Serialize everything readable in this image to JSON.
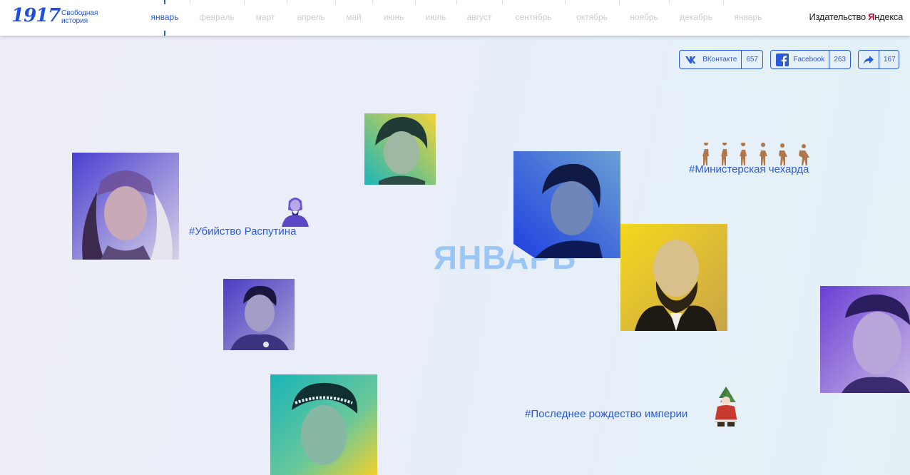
{
  "header": {
    "logo_number": "1917",
    "logo_subtitle": "Свободная история",
    "publisher_prefix": "Издательство ",
    "publisher_brand": "Я",
    "publisher_rest": "ндекса",
    "months": [
      {
        "label": "январь",
        "active": true
      },
      {
        "label": "февраль",
        "active": false
      },
      {
        "label": "март",
        "active": false
      },
      {
        "label": "апрель",
        "active": false
      },
      {
        "label": "май",
        "active": false
      },
      {
        "label": "июнь",
        "active": false
      },
      {
        "label": "июль",
        "active": false
      },
      {
        "label": "август",
        "active": false
      },
      {
        "label": "сентябрь",
        "active": false
      },
      {
        "label": "октябрь",
        "active": false
      },
      {
        "label": "ноябрь",
        "active": false
      },
      {
        "label": "декабрь",
        "active": false
      },
      {
        "label": "январь",
        "active": false
      }
    ]
  },
  "share": {
    "vk": {
      "label": "ВКонтакте",
      "count": "657",
      "icon": "vk-icon"
    },
    "facebook": {
      "label": "Facebook",
      "count": "263",
      "icon": "facebook-icon"
    },
    "repost": {
      "count": "167",
      "icon": "share-arrow-icon"
    }
  },
  "main": {
    "month_title": "ЯНВАРЬ",
    "tags": {
      "rasputin": "#Убийство Распутина",
      "ministers": "#Министерская чехарда",
      "christmas": "#Последнее рождество империи"
    }
  },
  "colors": {
    "accent": "#2b5bd8",
    "inactive_month": "#c9ccd4",
    "big_month": "#9cc6f6",
    "brand_red": "#d6002a"
  }
}
